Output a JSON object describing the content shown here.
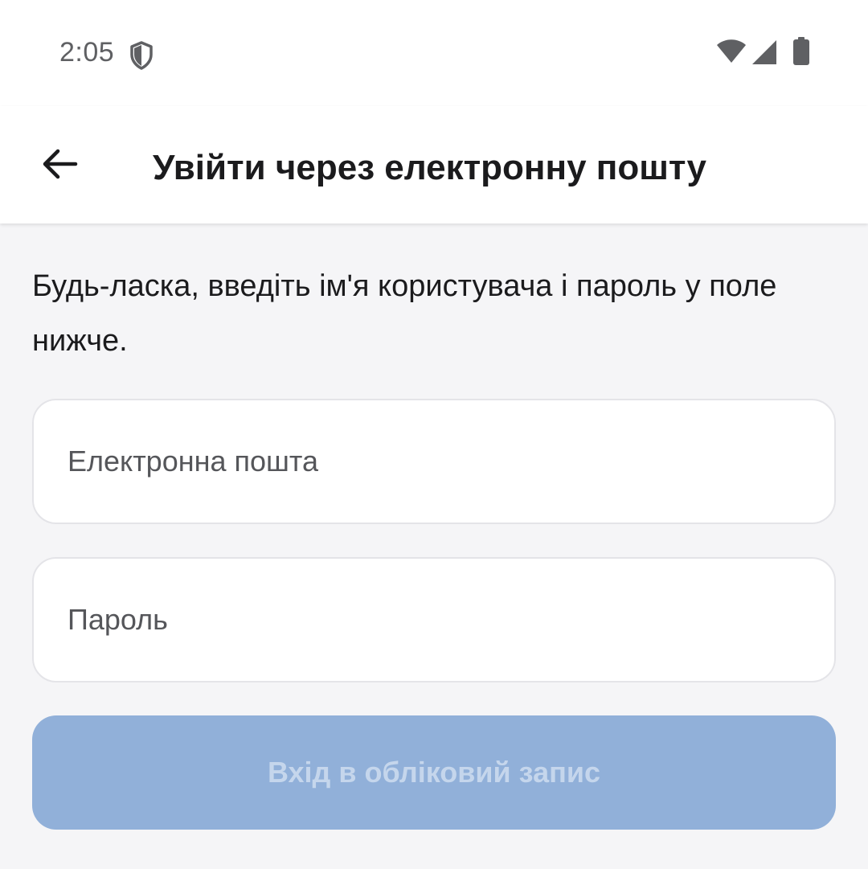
{
  "status_bar": {
    "time": "2:05",
    "icons": [
      "shield-icon",
      "wifi-icon",
      "signal-icon",
      "battery-icon"
    ]
  },
  "app_bar": {
    "back_icon": "arrow-left-icon",
    "title": "Увійти через електронну пошту"
  },
  "form": {
    "instructions": "Будь-ласка, введіть ім'я користувача і пароль у поле нижче.",
    "email": {
      "value": "",
      "placeholder": "Електронна пошта"
    },
    "password": {
      "value": "",
      "placeholder": "Пароль"
    },
    "submit_label": "Вхід в обліковий запис",
    "submit_enabled": false
  },
  "colors": {
    "background": "#f5f5f7",
    "surface": "#ffffff",
    "button_disabled": "#91b0d9",
    "button_text_disabled": "#c5d6ec",
    "text_primary": "#1b1b1d"
  }
}
